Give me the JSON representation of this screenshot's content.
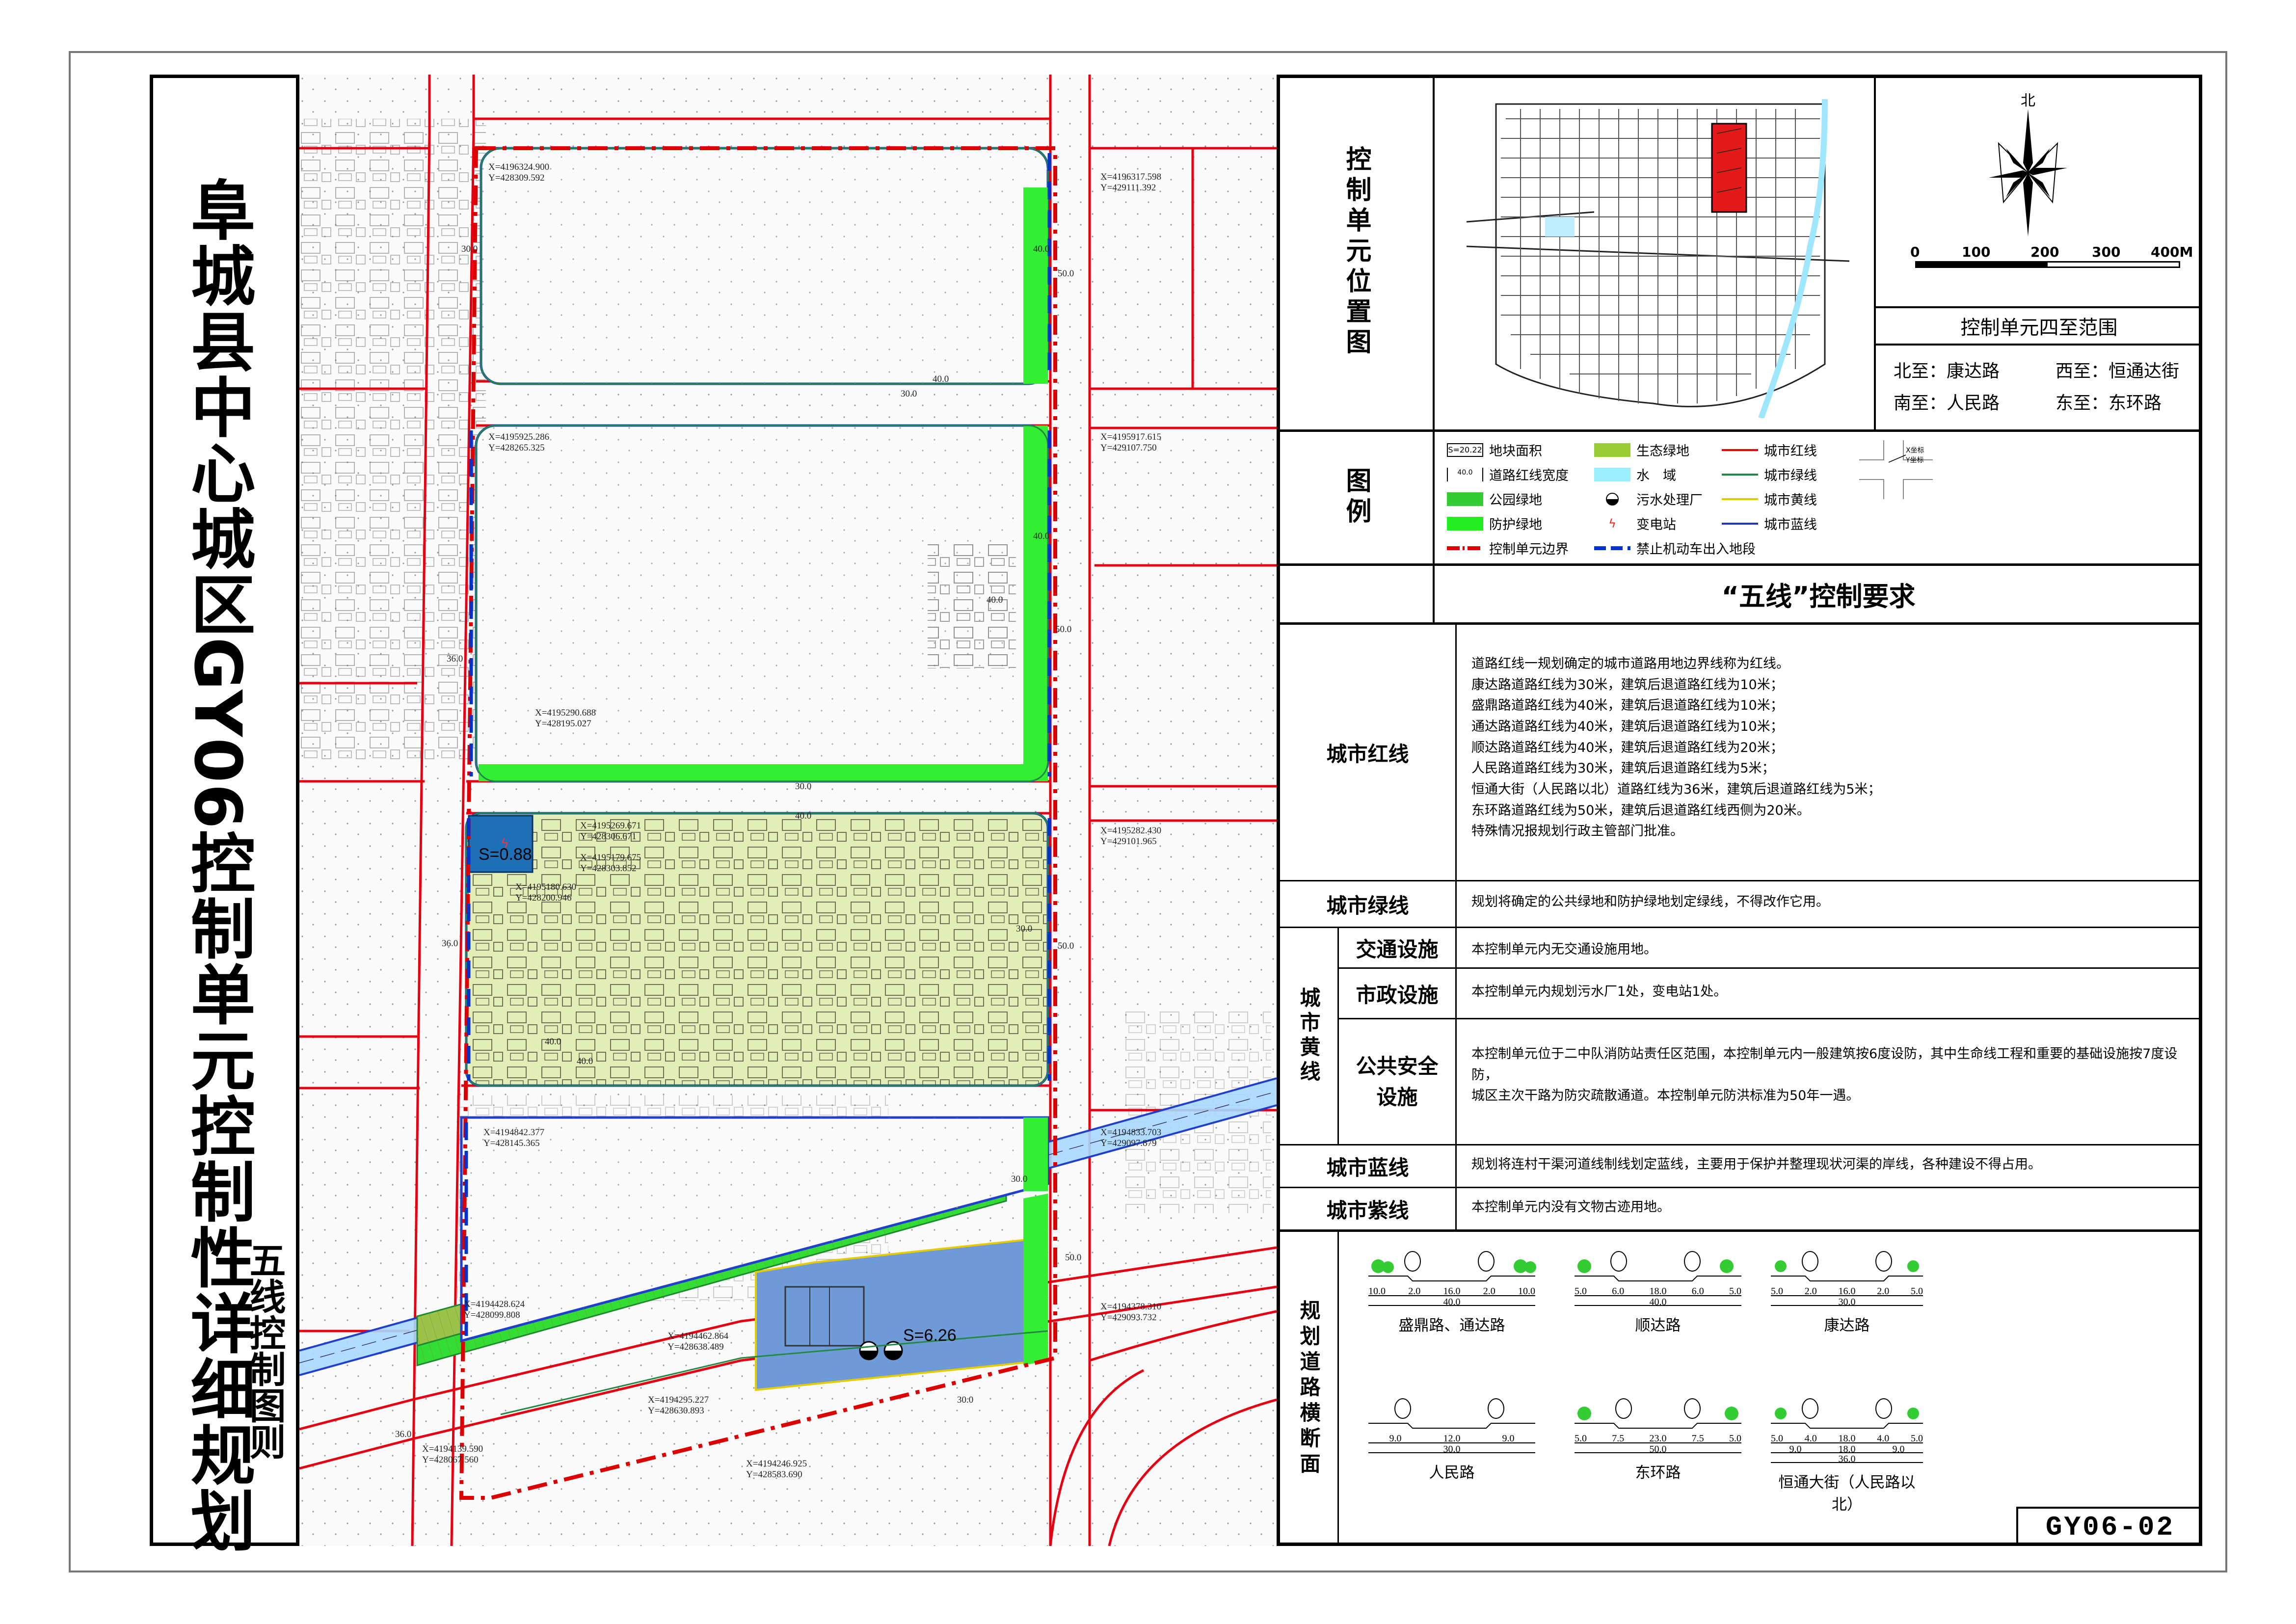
{
  "title": "阜城县中心城区GY06控制单元控制性详细规划",
  "subtitle": "五线控制图则",
  "drawing_number": "GY06-02",
  "panel": {
    "location_label": "控制单元位置图",
    "scale": {
      "north": "北",
      "ticks": [
        "0",
        "100",
        "200",
        "300",
        "400M"
      ]
    },
    "bounds_title": "控制单元四至范围",
    "bounds": {
      "north": "北至：康达路",
      "west": "西至：恒通达街",
      "south": "南至：人民路",
      "east": "东至：东环路"
    },
    "legend_label": "图例",
    "legend": [
      {
        "name": "s-box",
        "label": "地块面积",
        "symbol": "S=20.22",
        "kind": "box"
      },
      {
        "name": "road-width",
        "label": "道路红线宽度",
        "symbol": "40.0",
        "kind": "dim"
      },
      {
        "name": "park-green",
        "label": "公园绿地",
        "color": "#33cc33",
        "kind": "fill"
      },
      {
        "name": "protect-green",
        "label": "防护绿地",
        "color": "#22ee22",
        "kind": "fill"
      },
      {
        "name": "unit-boundary",
        "label": "控制单元边界",
        "color": "#dd0000",
        "kind": "dashdot"
      },
      {
        "name": "eco-green",
        "label": "生态绿地",
        "color": "#99cc33",
        "kind": "fill"
      },
      {
        "name": "water",
        "label": "水　域",
        "color": "#99eeff",
        "kind": "fill"
      },
      {
        "name": "sewage",
        "label": "污水处理厂",
        "kind": "sewage"
      },
      {
        "name": "substation",
        "label": "变电站",
        "kind": "substation"
      },
      {
        "name": "no-entry",
        "label": "禁止机动车出入地段",
        "color": "#0033cc",
        "kind": "dash"
      },
      {
        "name": "red-line",
        "label": "城市红线",
        "color": "#ee0000",
        "kind": "line"
      },
      {
        "name": "green-line",
        "label": "城市绿线",
        "color": "#228844",
        "kind": "line"
      },
      {
        "name": "yellow-line",
        "label": "城市黄线",
        "color": "#ddcc00",
        "kind": "line"
      },
      {
        "name": "blue-line",
        "label": "城市蓝线",
        "color": "#2233cc",
        "kind": "line"
      }
    ],
    "coord_key": {
      "x": "X坐标",
      "y": "Y坐标"
    },
    "five_lines_title": "“五线”控制要求",
    "red": {
      "label": "城市红线",
      "lines": [
        "道路红线一规划确定的城市道路用地边界线称为红线。",
        "康达路道路红线为30米，建筑后退道路红线为10米；",
        "盛鼎路道路红线为40米，建筑后退道路红线为10米；",
        "通达路道路红线为40米，建筑后退道路红线为10米；",
        "顺达路道路红线为40米，建筑后退道路红线为20米；",
        "人民路道路红线为30米，建筑后退道路红线为5米；",
        "恒通大街（人民路以北）道路红线为36米，建筑后退道路红线为5米；",
        "东环路道路红线为50米，建筑后退道路红线西侧为20米。",
        "特殊情况报规划行政主管部门批准。"
      ]
    },
    "green": {
      "label": "城市绿线",
      "text": "规划将确定的公共绿地和防护绿地划定绿线，不得改作它用。"
    },
    "yellow": {
      "label": "城市黄线",
      "traffic": {
        "label": "交通设施",
        "text": "本控制单元内无交通设施用地。"
      },
      "municipal": {
        "label": "市政设施",
        "text": "本控制单元内规划污水厂1处，变电站1处。"
      },
      "safety": {
        "label": "公共安全设施",
        "lines": [
          "本控制单元位于二中队消防站责任区范围，本控制单元内一般建筑按6度设防，其中生命线工程和重要的基础设施按7度设防，",
          "城区主次干路为防灾疏散通道。本控制单元防洪标准为50年一遇。"
        ]
      }
    },
    "blue": {
      "label": "城市蓝线",
      "text": "规划将连村干渠河道线制线划定蓝线，主要用于保护并整理现状河渠的岸线，各种建设不得占用。"
    },
    "purple": {
      "label": "城市紫线",
      "text": "本控制单元内没有文物古迹用地。"
    },
    "cross_section_label": "规划道路横断面",
    "sections": [
      {
        "name": "盛鼎路、通达路",
        "dims": [
          "10.0",
          "2.0",
          "16.0",
          "2.0",
          "10.0"
        ],
        "total": "40.0"
      },
      {
        "name": "顺达路",
        "dims": [
          "5.0",
          "6.0",
          "18.0",
          "6.0",
          "5.0"
        ],
        "total": "40.0"
      },
      {
        "name": "康达路",
        "dims": [
          "5.0",
          "2.0",
          "16.0",
          "2.0",
          "5.0"
        ],
        "total": "30.0"
      },
      {
        "name": "人民路",
        "dims": [
          "9.0",
          "12.0",
          "9.0"
        ],
        "total": "30.0"
      },
      {
        "name": "东环路",
        "dims": [
          "5.0",
          "7.5",
          "23.0",
          "7.5",
          "5.0"
        ],
        "total": "50.0"
      },
      {
        "name": "恒通大街（人民路以北）",
        "dims": [
          "5.0",
          "4.0",
          "18.0",
          "4.0",
          "5.0"
        ],
        "sub": [
          "9.0",
          "18.0",
          "9.0"
        ],
        "total": "36.0"
      }
    ]
  },
  "map": {
    "plot_area_1": "S=0.88",
    "plot_area_2": "S=6.26",
    "coords": [
      "X=4196324.900\nY=428309.592",
      "X=4196317.598\nY=429111.392",
      "X=4195925.286\nY=428265.325",
      "X=4195917.615\nY=429107.750",
      "X=4195290.688\nY=428195.027",
      "X=4195269.671\nY=428306.671",
      "X=4195179.675\nY=428303.852",
      "X=4195180.630\nY=428200.946",
      "X=4195282.430\nY=429101.965",
      "X=4194842.377\nY=428145.365",
      "X=4194833.703\nY=429097.879",
      "X=4194428.624\nY=428099.808",
      "X=4194462.864\nY=428638.489",
      "X=4194378.310\nY=429093.732",
      "X=4194295.227\nY=428630.893",
      "X=4194139.590\nY=428067.560",
      "X=4194246.925\nY=428583.690"
    ],
    "dims": [
      "30.0",
      "40.0",
      "50.0",
      "30.0",
      "40.0",
      "40.0",
      "40.0",
      "50.0",
      "36.0",
      "36.0",
      "30.0",
      "40.0",
      "40.0",
      "30.0",
      "50.0",
      "40.0",
      "30.0",
      "50.0",
      "30.0",
      "36.0"
    ]
  }
}
